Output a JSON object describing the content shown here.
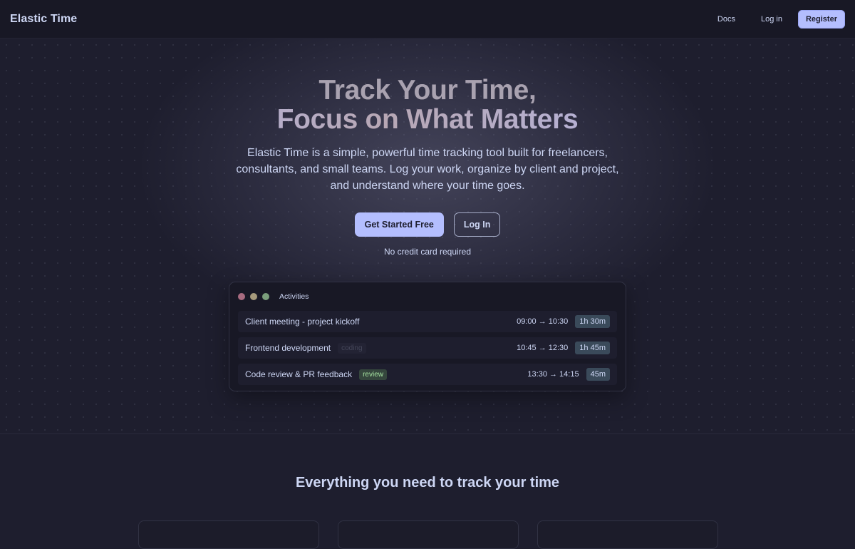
{
  "nav": {
    "brand": "Elastic Time",
    "docs": "Docs",
    "login": "Log in",
    "register": "Register"
  },
  "hero": {
    "title_line1": "Track Your Time,",
    "title_line2": "Focus on What Matters",
    "subtitle": "Elastic Time is a simple, powerful time tracking tool built for freelancers, consultants, and small teams. Log your work, organize by client and project, and understand where your time goes.",
    "cta_primary": "Get Started Free",
    "cta_secondary": "Log In",
    "note": "No credit card required"
  },
  "preview": {
    "title": "Activities",
    "window_dots": [
      "red-dot",
      "yellow-dot",
      "green-dot"
    ],
    "activities": [
      {
        "name": "Client meeting - project kickoff",
        "tag": "",
        "time": "09:00 → 10:30",
        "duration": "1h 30m"
      },
      {
        "name": "Frontend development",
        "tag": "coding",
        "time": "10:45 → 12:30",
        "duration": "1h 45m"
      },
      {
        "name": "Code review & PR feedback",
        "tag": "review",
        "time": "13:30 → 14:15",
        "duration": "45m"
      }
    ]
  },
  "features": {
    "title": "Everything you need to track your time"
  },
  "colors": {
    "background": "#1e1e2e",
    "navbar": "#181825",
    "accent": "#b4befe",
    "text": "#cdd6f4",
    "review_tag": "#a6e3a1"
  }
}
